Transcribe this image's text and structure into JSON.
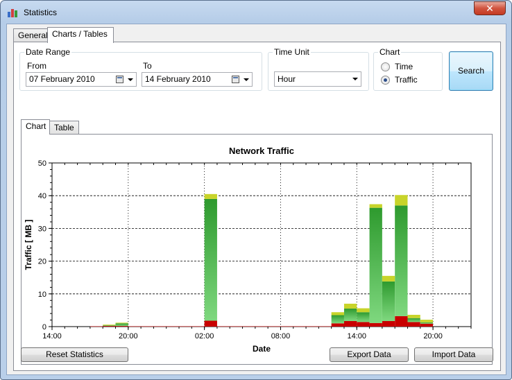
{
  "window": {
    "title": "Statistics",
    "close_label": "✕"
  },
  "tabs": [
    {
      "label": "General"
    },
    {
      "label": "Charts / Tables"
    }
  ],
  "date_range": {
    "label": "Date Range",
    "from_label": "From",
    "from_value": "07  February  2010",
    "to_label": "To",
    "to_value": "14  February  2010"
  },
  "time_unit": {
    "label": "Time Unit",
    "value": "Hour"
  },
  "chart_mode": {
    "label": "Chart",
    "options": [
      {
        "label": "Time",
        "checked": false
      },
      {
        "label": "Traffic",
        "checked": true
      }
    ]
  },
  "search_label": "Search",
  "inner_tabs": [
    {
      "label": "Chart"
    },
    {
      "label": "Table"
    }
  ],
  "buttons": {
    "reset": "Reset Statistics",
    "export": "Export Data",
    "import": "Import Data"
  },
  "chart_data": {
    "type": "bar",
    "stacked": true,
    "title": "Network Traffic",
    "xlabel": "Date",
    "ylabel": "Traffic [ MB ]",
    "ylim": [
      0,
      50
    ],
    "yticks": [
      0,
      10,
      20,
      30,
      40,
      50
    ],
    "x_tick_labels": [
      "14:00",
      "20:00",
      "02:00",
      "08:00",
      "14:00",
      "20:00"
    ],
    "x_hours_range": [
      14,
      47
    ],
    "grid": true,
    "series": [
      {
        "color": "#c80000",
        "points": [
          [
            17,
            0.1
          ],
          [
            18,
            0.2
          ],
          [
            19,
            0.2
          ],
          [
            20,
            0.1
          ],
          [
            21,
            0.1
          ],
          [
            22,
            0.1
          ],
          [
            23,
            0.1
          ],
          [
            24,
            0.1
          ],
          [
            25,
            0.1
          ],
          [
            26,
            1.8
          ],
          [
            27,
            0.1
          ],
          [
            28,
            0.1
          ],
          [
            29,
            0.1
          ],
          [
            30,
            0.1
          ],
          [
            31,
            0.1
          ],
          [
            32,
            0.1
          ],
          [
            33,
            0.1
          ],
          [
            34,
            0.1
          ],
          [
            35,
            0.1
          ],
          [
            36,
            1.0
          ],
          [
            37,
            1.7
          ],
          [
            38,
            1.4
          ],
          [
            39,
            1.1
          ],
          [
            40,
            1.7
          ],
          [
            41,
            3.2
          ],
          [
            42,
            1.4
          ],
          [
            43,
            0.9
          ]
        ]
      },
      {
        "color": "#3aa83a",
        "points": [
          [
            18,
            0.2
          ],
          [
            19,
            0.8
          ],
          [
            26,
            37.2
          ],
          [
            36,
            2.5
          ],
          [
            37,
            3.8
          ],
          [
            38,
            3.0
          ],
          [
            39,
            35.2
          ],
          [
            40,
            12.1
          ],
          [
            41,
            33.8
          ],
          [
            42,
            1.2
          ],
          [
            43,
            0.4
          ]
        ]
      },
      {
        "color": "#c8d42a",
        "points": [
          [
            18,
            0.2
          ],
          [
            19,
            0.2
          ],
          [
            26,
            1.5
          ],
          [
            36,
            0.9
          ],
          [
            37,
            1.5
          ],
          [
            38,
            1.2
          ],
          [
            39,
            1.1
          ],
          [
            40,
            1.7
          ],
          [
            41,
            3.2
          ],
          [
            42,
            1.0
          ],
          [
            43,
            0.8
          ]
        ]
      }
    ]
  },
  "colors": {
    "series_red": "#c80000",
    "series_green": "#3aa83a",
    "series_yellow": "#c8d42a",
    "window_frame": "#b9cfe9"
  }
}
